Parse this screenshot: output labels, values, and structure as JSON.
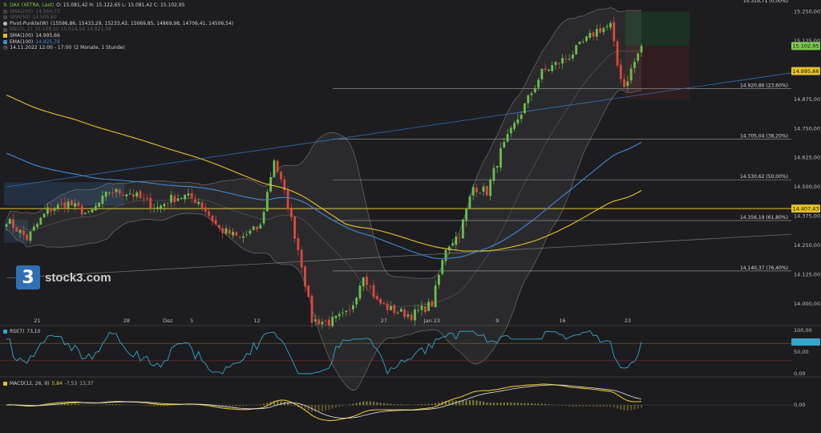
{
  "legend": {
    "main": {
      "label": "DAX (XETRA, Last)",
      "ohlc": "O: 15.081,42  H: 15.122,65  L: 15.081,42  C: 15.102,95",
      "color": "#7ec850"
    },
    "faded1": {
      "label": "SMA(200)",
      "value": "14.564,73"
    },
    "faded2": {
      "label": "SMA(50)",
      "value": "14.505,82"
    },
    "pivot": {
      "label": "Pivot-Punkte(W)",
      "values": "(15596,86, 15433,29, 15233,42, 15069,85, 14869,98, 14706,41, 14506,54)"
    },
    "bb": {
      "label": "BB(25, 2)",
      "values": "15.108,50  15.014,54  14.821,38"
    },
    "sma100": {
      "label": "SMA(100)",
      "value": "14.995,66",
      "color": "#e6c229"
    },
    "ema100": {
      "label": "EMA(100)",
      "value": "14.925,76",
      "color": "#3d8bd6"
    },
    "range": {
      "label": "14.11.2022 12:00 - 17:00",
      "detail": "(2 Monate, 1 Stunde)"
    }
  },
  "logo": {
    "mark": "3",
    "text": "stock3.com"
  },
  "rsi_label": {
    "name": "RSI(7)",
    "value": "73,10"
  },
  "macd_label": {
    "name": "MACD(12, 26, 9)",
    "v1": "5,84",
    "v2": "-7,53",
    "v3": "13,37"
  },
  "colors": {
    "up": "#6bbf4e",
    "down": "#e0463c",
    "sma": "#e6c229",
    "ema": "#3d8bd6",
    "rsi": "#35a6c9",
    "macd": "#f0f0f0",
    "signal": "#e6c229"
  },
  "chart_data": [
    {
      "type": "candlestick",
      "panel": "price",
      "ylim": [
        13910,
        15300
      ],
      "y_ticks": [
        "15.250,00",
        "15.125,00",
        "14.875,00",
        "14.750,00",
        "14.625,00",
        "14.500,00",
        "14.375,00",
        "14.250,00",
        "14.125,00",
        "14.000,00"
      ],
      "y_tick_values": [
        15250,
        15125,
        14875,
        14750,
        14625,
        14500,
        14375,
        14250,
        14125,
        14000
      ],
      "x_ticks": [
        "21",
        "28",
        "Dez",
        "5",
        "12",
        "27",
        "Jan 23",
        "9",
        "16",
        "23"
      ],
      "x_tick_idx": [
        9,
        35,
        47,
        54,
        73,
        110,
        124,
        143,
        162,
        181
      ],
      "n_candles": 186,
      "close_anchors": [
        [
          0,
          14360
        ],
        [
          6,
          14280
        ],
        [
          12,
          14400
        ],
        [
          18,
          14430
        ],
        [
          24,
          14380
        ],
        [
          30,
          14480
        ],
        [
          36,
          14475
        ],
        [
          44,
          14410
        ],
        [
          48,
          14450
        ],
        [
          52,
          14460
        ],
        [
          56,
          14440
        ],
        [
          62,
          14320
        ],
        [
          68,
          14280
        ],
        [
          74,
          14330
        ],
        [
          78,
          14620
        ],
        [
          82,
          14420
        ],
        [
          86,
          14170
        ],
        [
          89,
          13930
        ],
        [
          94,
          13920
        ],
        [
          100,
          13960
        ],
        [
          104,
          14130
        ],
        [
          108,
          14010
        ],
        [
          112,
          13975
        ],
        [
          118,
          13950
        ],
        [
          124,
          14000
        ],
        [
          128,
          14240
        ],
        [
          132,
          14300
        ],
        [
          136,
          14500
        ],
        [
          140,
          14480
        ],
        [
          144,
          14650
        ],
        [
          150,
          14820
        ],
        [
          156,
          14990
        ],
        [
          164,
          15060
        ],
        [
          172,
          15170
        ],
        [
          176,
          15190
        ],
        [
          178,
          15020
        ],
        [
          180,
          14930
        ],
        [
          182,
          15000
        ],
        [
          185,
          15103
        ]
      ],
      "fib_levels": [
        {
          "label": "15.319,71 (0,00%)",
          "value": 15319.71
        },
        {
          "label": "14.920,86 (23,60%)",
          "value": 14920.86
        },
        {
          "label": "14.705,04 (38,20%)",
          "value": 14705.04
        },
        {
          "label": "14.530,62 (50,00%)",
          "value": 14530.62
        },
        {
          "label": "14.356,19 (61,80%)",
          "value": 14356.19
        },
        {
          "label": "14.140,37 (76,40%)",
          "value": 14140.37
        }
      ],
      "price_tags": [
        {
          "label": "15.102,95",
          "value": 15102.95,
          "color": "#7ec850"
        },
        {
          "label": "14.995,66",
          "value": 14995.66,
          "color": "#e6c229"
        },
        {
          "label": "14.407,43",
          "value": 14407.43,
          "color": "#e6c229"
        }
      ],
      "trendline_blue": [
        [
          0,
          14500
        ],
        [
          232,
          14995
        ]
      ],
      "trendline_grey": [
        [
          0,
          14110
        ],
        [
          232,
          14300
        ]
      ]
    },
    {
      "type": "line",
      "panel": "rsi",
      "name": "RSI(7)",
      "ylim": [
        0,
        100
      ],
      "y_ticks": [
        "100,00",
        "50,00",
        "0,00"
      ],
      "y_tick_values": [
        100,
        50,
        0
      ],
      "levels": [
        70,
        30
      ],
      "last": 73.1
    },
    {
      "type": "bar+line",
      "panel": "macd",
      "name": "MACD(12, 26, 9)",
      "y_ticks": [
        "0,00"
      ],
      "y_tick_values": [
        0
      ],
      "last": {
        "macd": 5.84,
        "signal": -7.53,
        "hist": 13.37
      }
    }
  ]
}
